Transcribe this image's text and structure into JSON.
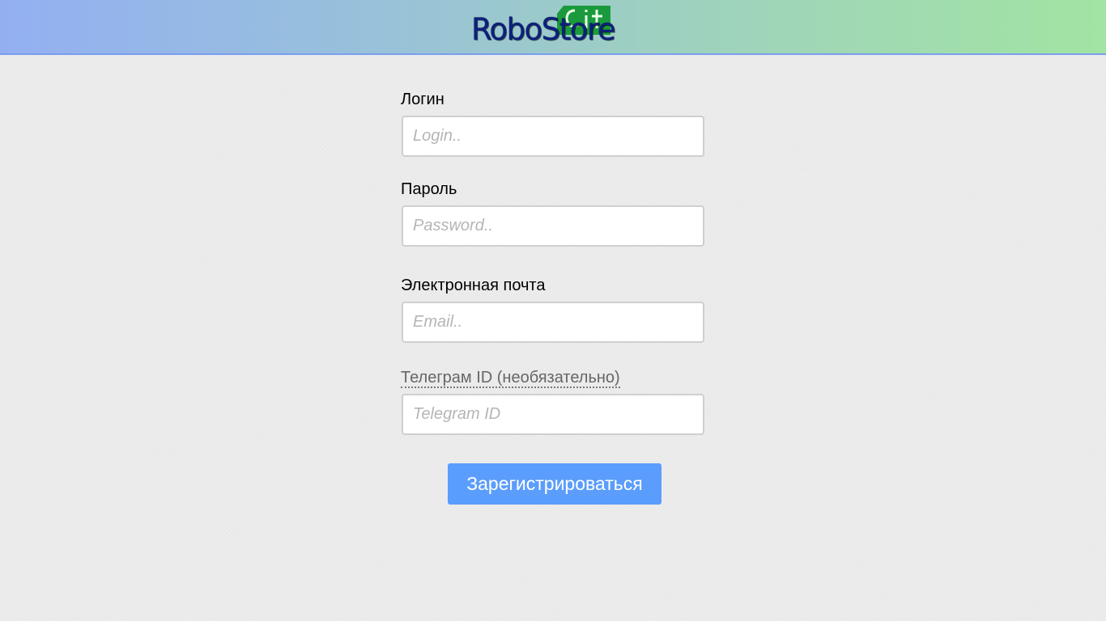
{
  "header": {
    "logo_text": "RoboStore",
    "logo_badge_text": "Git",
    "logo_badge_color": "#1a9a3c",
    "logo_text_color": "#0c2080"
  },
  "form": {
    "login": {
      "label": "Логин",
      "placeholder": "Login.."
    },
    "password": {
      "label": "Пароль",
      "placeholder": "Password.."
    },
    "email": {
      "label": "Электронная почта",
      "placeholder": "Email.."
    },
    "telegram": {
      "label": "Телеграм ID (необязательно)",
      "placeholder": "Telegram ID"
    },
    "submit_label": "Зарегистрироваться"
  },
  "colors": {
    "button": "#5b9dfc",
    "header_gradient_start": "#93aff2",
    "header_gradient_end": "#a2e4a2",
    "page_background": "#ebebeb"
  }
}
